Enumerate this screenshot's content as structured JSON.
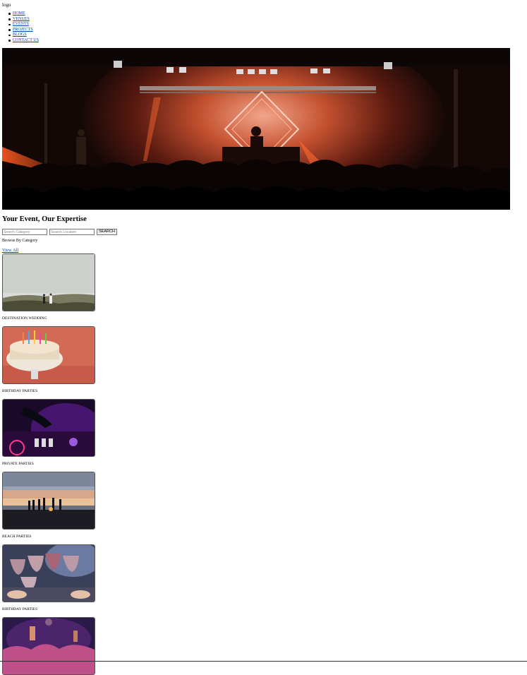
{
  "header": {
    "logo": "logo"
  },
  "nav": {
    "items": [
      {
        "label": "HOME"
      },
      {
        "label": "VENUES"
      },
      {
        "label": "EVENTS"
      },
      {
        "label": "PROJECTS"
      },
      {
        "label": "BLOGS"
      },
      {
        "label": "CONTACT US"
      }
    ]
  },
  "hero": {
    "image": "concert-dj-stage-crowd"
  },
  "main": {
    "title": "Your Event, Our Expertise",
    "search": {
      "category_placeholder": "Search Category",
      "location_placeholder": "Search Location",
      "button": "SEARCH"
    },
    "browse_label": "Browse By Category",
    "view_all": "View All"
  },
  "categories": [
    {
      "label": "DESTINATION WEDDING",
      "image": "couple-on-hill"
    },
    {
      "label": "BIRTHDAY PARTIES",
      "image": "birthday-cake"
    },
    {
      "label": "PRIVATE PARTIES",
      "image": "dj-mixer-purple"
    },
    {
      "label": "BEACH PARTIES",
      "image": "beach-sunset-group"
    },
    {
      "label": "BIRTHDAY PARTIES",
      "image": "wine-glasses-toast"
    },
    {
      "label": "",
      "image": "concert-crowd"
    }
  ]
}
